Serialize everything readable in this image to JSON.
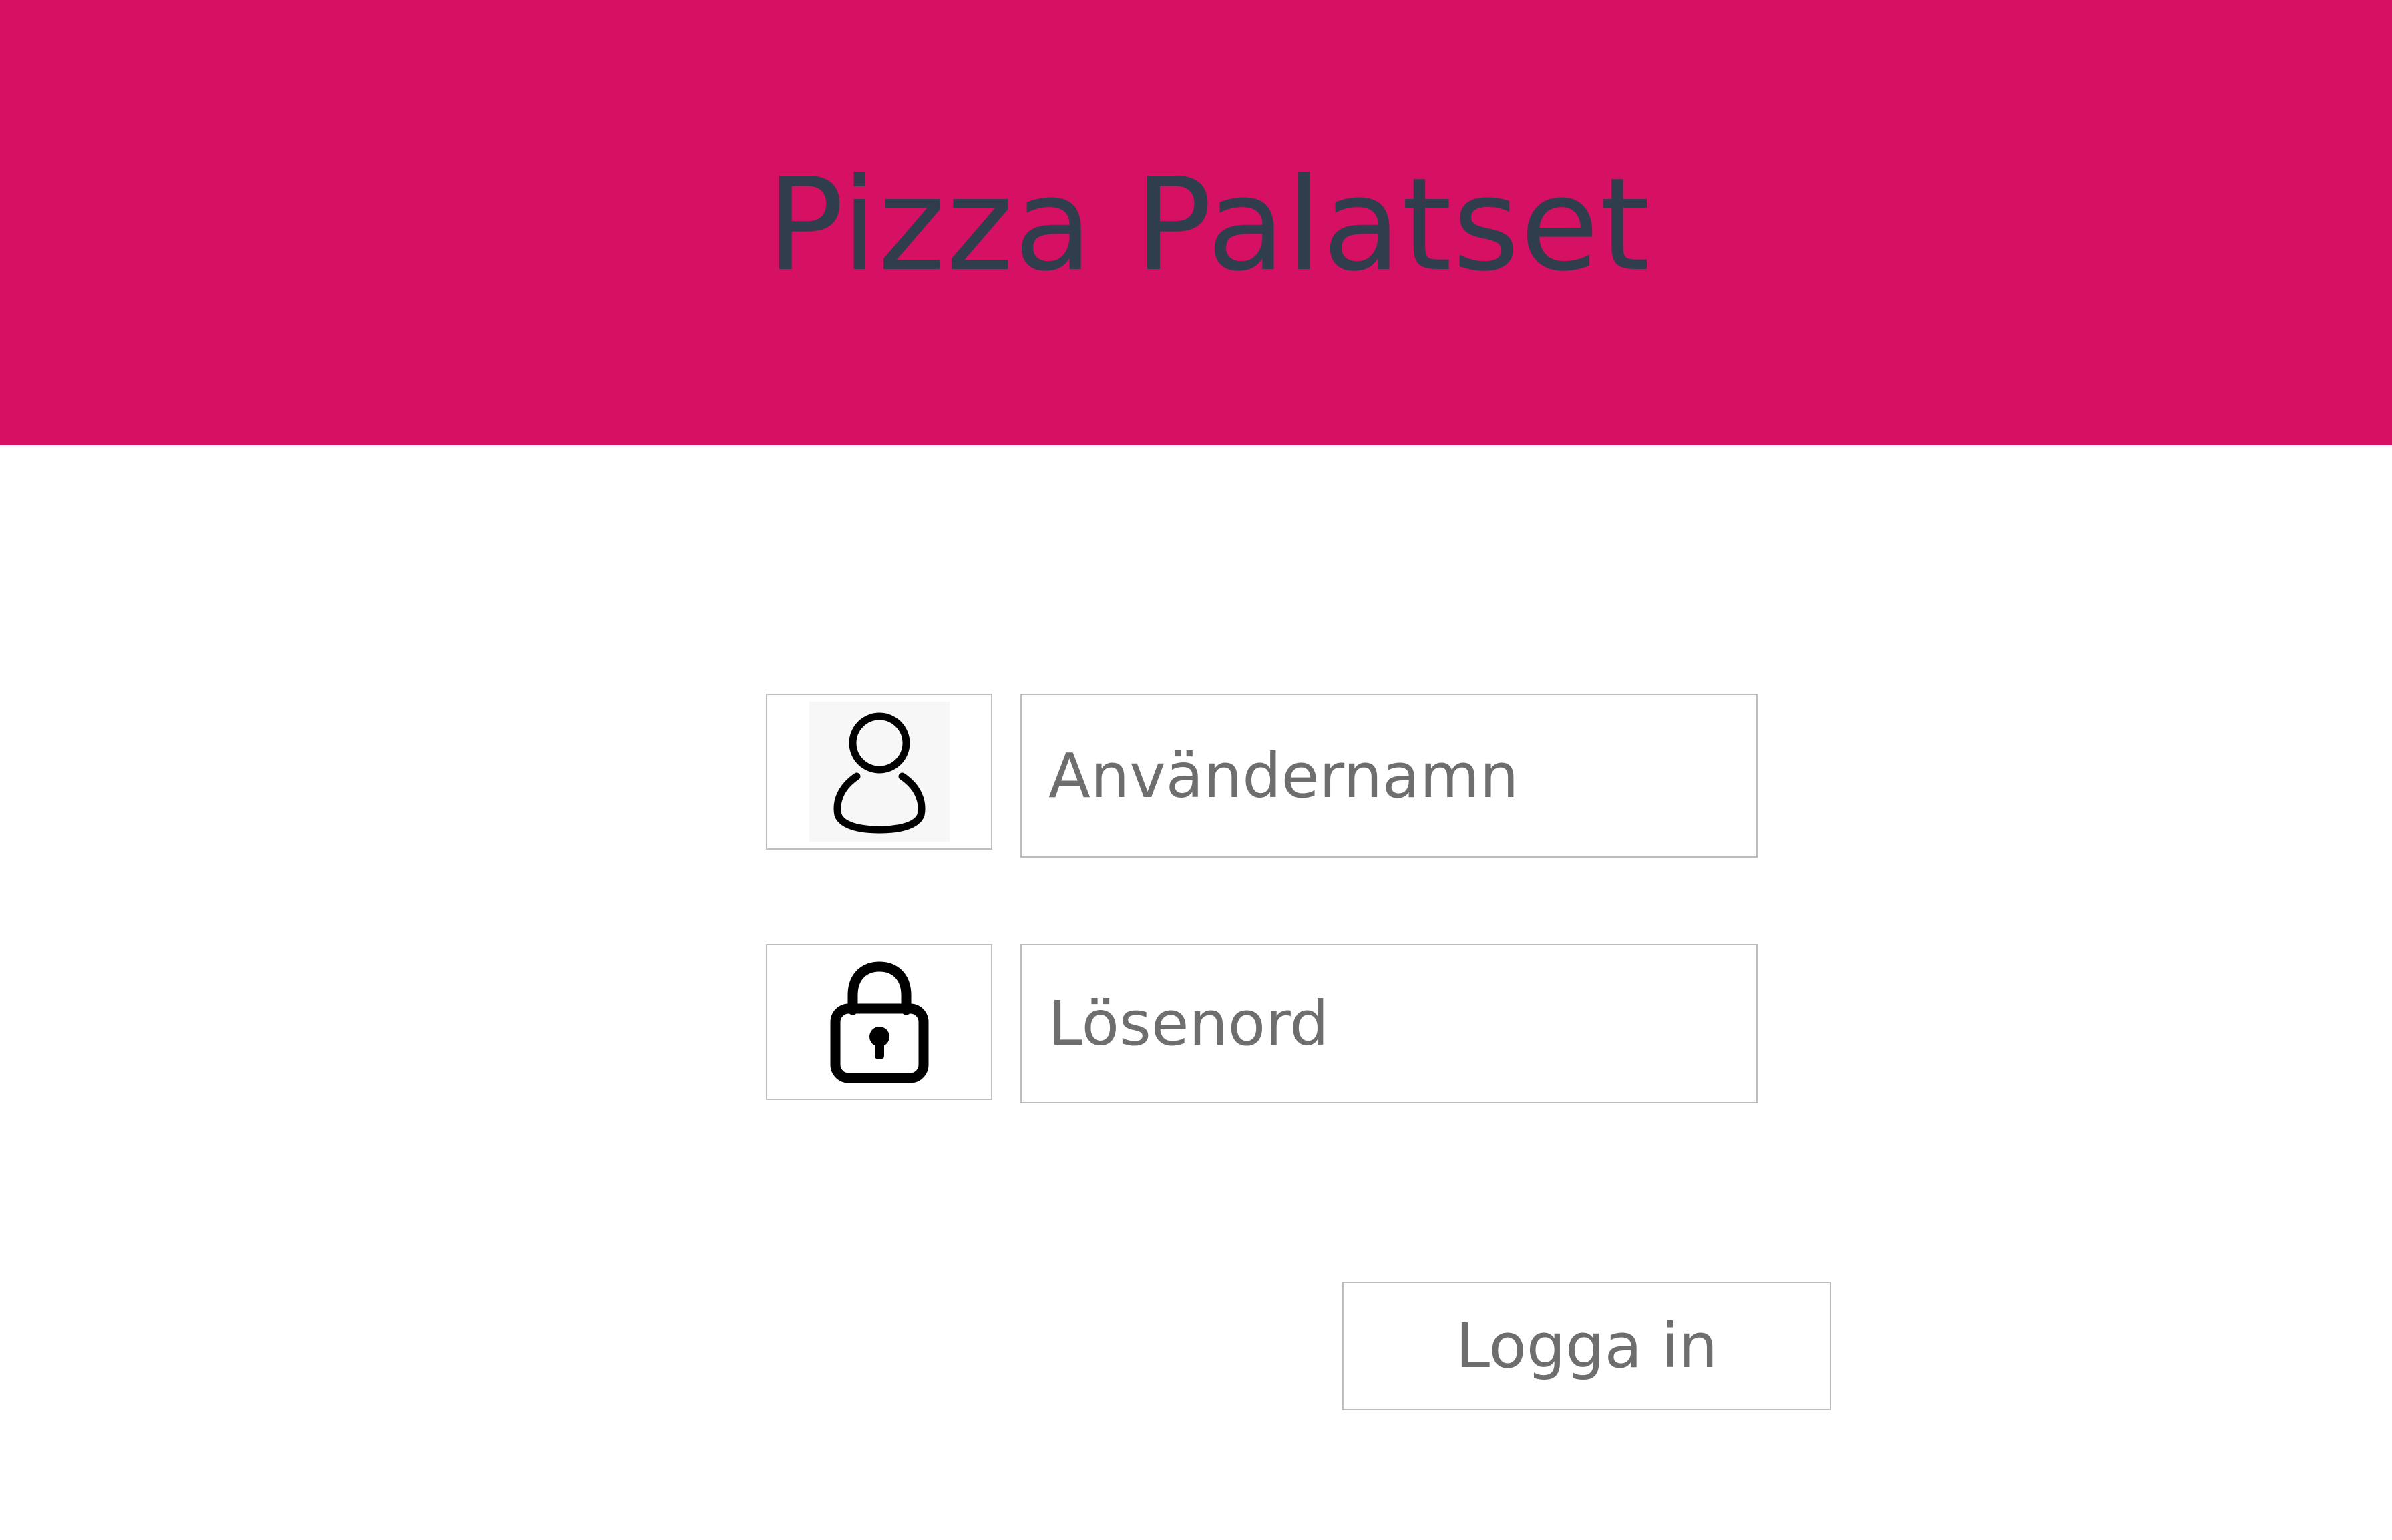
{
  "colors": {
    "header_background": "#d61163",
    "title_text": "#2f3d4c",
    "border": "#bdbdbd",
    "placeholder_text": "#6e6e6e"
  },
  "header": {
    "title": "Pizza Palatset"
  },
  "login_form": {
    "username": {
      "icon": "user-icon",
      "value": "",
      "placeholder": "Användernamn"
    },
    "password": {
      "icon": "lock-icon",
      "value": "",
      "placeholder": "Lösenord"
    },
    "submit_label": "Logga in"
  }
}
